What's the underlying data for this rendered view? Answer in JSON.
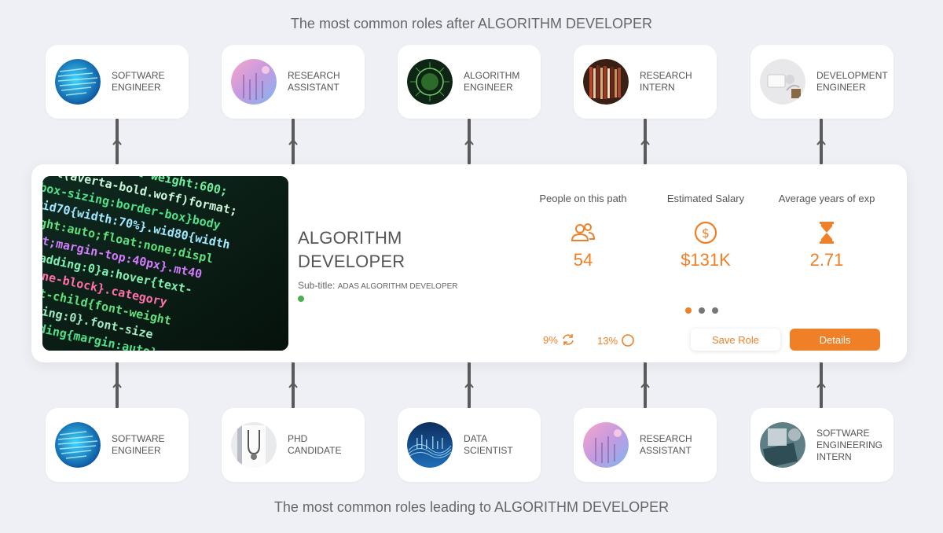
{
  "header": {
    "title": "The most common roles after ALGORITHM DEVELOPER"
  },
  "footer": {
    "title": "The most common roles leading to ALGORITHM DEVELOPER"
  },
  "next_roles": [
    {
      "label": "SOFTWARE ENGINEER",
      "icon": "code-thumbnail"
    },
    {
      "label": "RESEARCH ASSISTANT",
      "icon": "lab-thumbnail"
    },
    {
      "label": "ALGORITHM ENGINEER",
      "icon": "circuit-thumbnail"
    },
    {
      "label": "RESEARCH INTERN",
      "icon": "library-thumbnail"
    },
    {
      "label": "DEVELOPMENT ENGINEER",
      "icon": "workspace-thumbnail"
    }
  ],
  "previous_roles": [
    {
      "label": "SOFTWARE ENGINEER",
      "icon": "code-thumbnail"
    },
    {
      "label": "PHD CANDIDATE",
      "icon": "doctor-thumbnail"
    },
    {
      "label": "DATA SCIENTIST",
      "icon": "data-wave-thumbnail"
    },
    {
      "label": "RESEARCH ASSISTANT",
      "icon": "lab-thumbnail"
    },
    {
      "label": "SOFTWARE ENGINEERING INTERN",
      "icon": "laptop-thumbnail"
    }
  ],
  "role": {
    "title_line1": "ALGORITHM",
    "title_line2": "DEVELOPER",
    "subtitle_label": "Sub-title:",
    "subtitle_value": "ADAS ALGORITHM DEVELOPER"
  },
  "stats": {
    "people": {
      "label": "People on this path",
      "value": "54",
      "icon": "people-icon"
    },
    "salary": {
      "label": "Estimated Salary",
      "value": "$131K",
      "icon": "dollar-icon"
    },
    "experience": {
      "label": "Average years of exp",
      "value": "2.71",
      "icon": "hourglass-icon"
    }
  },
  "metrics": {
    "cycle": {
      "value": "9%",
      "icon": "refresh-icon"
    },
    "circle": {
      "value": "13%",
      "icon": "circle-icon"
    }
  },
  "buttons": {
    "save": "Save Role",
    "details": "Details"
  },
  "carousel": {
    "count": 3,
    "active": 0
  },
  "colors": {
    "accent": "#f08028",
    "status": "#4caf50",
    "background": "#eef0f6"
  }
}
